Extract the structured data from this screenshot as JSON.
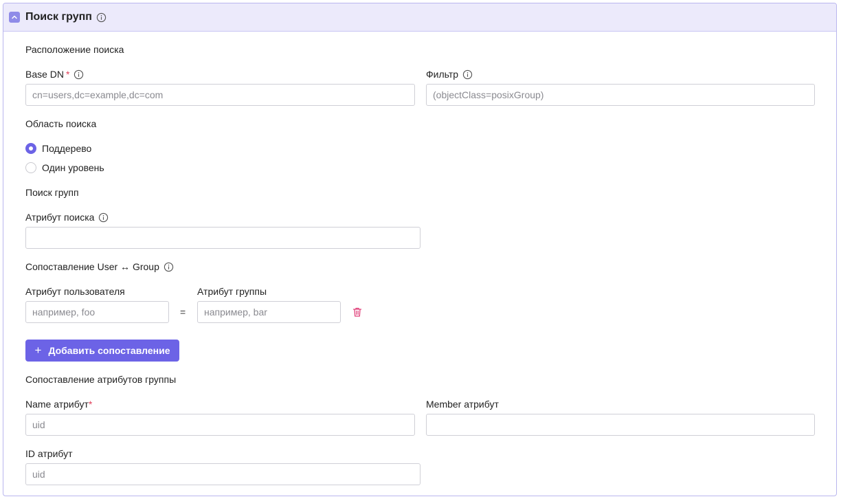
{
  "header": {
    "title": "Поиск групп"
  },
  "search_location": {
    "section_label": "Расположение поиска",
    "base_dn": {
      "label": "Base DN",
      "required_mark": "*",
      "value": "",
      "placeholder": "cn=users,dc=example,dc=com"
    },
    "filter": {
      "label": "Фильтр",
      "value": "",
      "placeholder": "(objectClass=posixGroup)"
    }
  },
  "search_scope": {
    "section_label": "Область поиска",
    "options": [
      {
        "label": "Поддерево",
        "checked": true
      },
      {
        "label": "Один уровень",
        "checked": false
      }
    ]
  },
  "group_search": {
    "section_label": "Поиск групп",
    "search_attribute": {
      "label": "Атрибут поиска",
      "value": "",
      "placeholder": ""
    }
  },
  "mapping": {
    "section_label": "Сопоставление User ↔ Group",
    "user_attr": {
      "label": "Атрибут пользователя",
      "placeholder": "например, foo"
    },
    "equals": "=",
    "group_attr": {
      "label": "Атрибут группы",
      "placeholder": "например, bar"
    },
    "add_button": {
      "icon": "+",
      "label": "Добавить сопоставление"
    }
  },
  "group_attributes": {
    "section_label": "Сопоставление атрибутов группы",
    "name_attr": {
      "label": "Name атрибут",
      "required_mark": "*",
      "placeholder": "uid"
    },
    "member_attr": {
      "label": "Member атрибут",
      "placeholder": ""
    },
    "id_attr": {
      "label": "ID атрибут",
      "placeholder": "uid"
    }
  },
  "colors": {
    "accent": "#6c63e6",
    "header_bg": "#eceafb",
    "border": "#b9b6ee",
    "required": "#e0405a",
    "danger": "#e0407a"
  }
}
